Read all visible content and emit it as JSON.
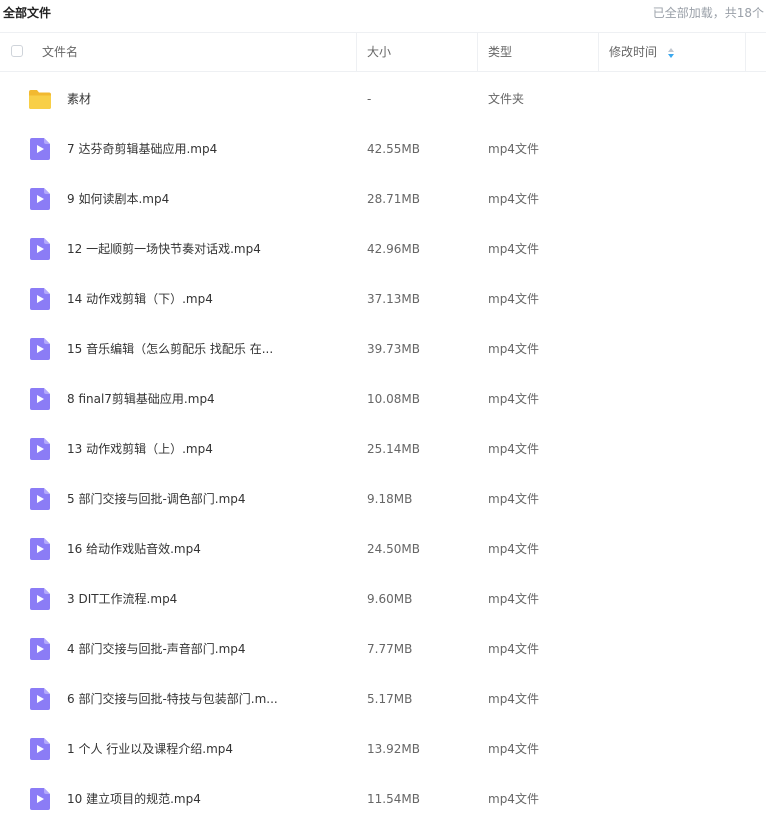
{
  "header_bar": {
    "title": "全部文件",
    "status": "已全部加载，共18个"
  },
  "columns": {
    "name": "文件名",
    "size": "大小",
    "type": "类型",
    "modified": "修改时间"
  },
  "rows": [
    {
      "kind": "folder",
      "icon": "folder-icon",
      "name": "素材",
      "size": "-",
      "type": "文件夹"
    },
    {
      "kind": "video",
      "icon": "video-file-icon",
      "name": "7 达芬奇剪辑基础应用.mp4",
      "size": "42.55MB",
      "type": "mp4文件"
    },
    {
      "kind": "video",
      "icon": "video-file-icon",
      "name": "9 如何读剧本.mp4",
      "size": "28.71MB",
      "type": "mp4文件"
    },
    {
      "kind": "video",
      "icon": "video-file-icon",
      "name": "12 一起顺剪一场快节奏对话戏.mp4",
      "size": "42.96MB",
      "type": "mp4文件"
    },
    {
      "kind": "video",
      "icon": "video-file-icon",
      "name": "14 动作戏剪辑（下）.mp4",
      "size": "37.13MB",
      "type": "mp4文件"
    },
    {
      "kind": "video",
      "icon": "video-file-icon",
      "name": "15 音乐编辑（怎么剪配乐 找配乐 在...",
      "size": "39.73MB",
      "type": "mp4文件"
    },
    {
      "kind": "video",
      "icon": "video-file-icon",
      "name": "8 final7剪辑基础应用.mp4",
      "size": "10.08MB",
      "type": "mp4文件"
    },
    {
      "kind": "video",
      "icon": "video-file-icon",
      "name": "13 动作戏剪辑（上）.mp4",
      "size": "25.14MB",
      "type": "mp4文件"
    },
    {
      "kind": "video",
      "icon": "video-file-icon",
      "name": "5 部门交接与回批-调色部门.mp4",
      "size": "9.18MB",
      "type": "mp4文件"
    },
    {
      "kind": "video",
      "icon": "video-file-icon",
      "name": "16 给动作戏贴音效.mp4",
      "size": "24.50MB",
      "type": "mp4文件"
    },
    {
      "kind": "video",
      "icon": "video-file-icon",
      "name": "3 DIT工作流程.mp4",
      "size": "9.60MB",
      "type": "mp4文件"
    },
    {
      "kind": "video",
      "icon": "video-file-icon",
      "name": "4 部门交接与回批-声音部门.mp4",
      "size": "7.77MB",
      "type": "mp4文件"
    },
    {
      "kind": "video",
      "icon": "video-file-icon",
      "name": "6 部门交接与回批-特技与包装部门.m...",
      "size": "5.17MB",
      "type": "mp4文件"
    },
    {
      "kind": "video",
      "icon": "video-file-icon",
      "name": "1 个人 行业以及课程介绍.mp4",
      "size": "13.92MB",
      "type": "mp4文件"
    },
    {
      "kind": "video",
      "icon": "video-file-icon",
      "name": "10 建立项目的规范.mp4",
      "size": "11.54MB",
      "type": "mp4文件"
    }
  ],
  "colors": {
    "folder": "#f5c542",
    "video_icon": "#8b7cf6",
    "sort_active": "#3aa8ef"
  }
}
